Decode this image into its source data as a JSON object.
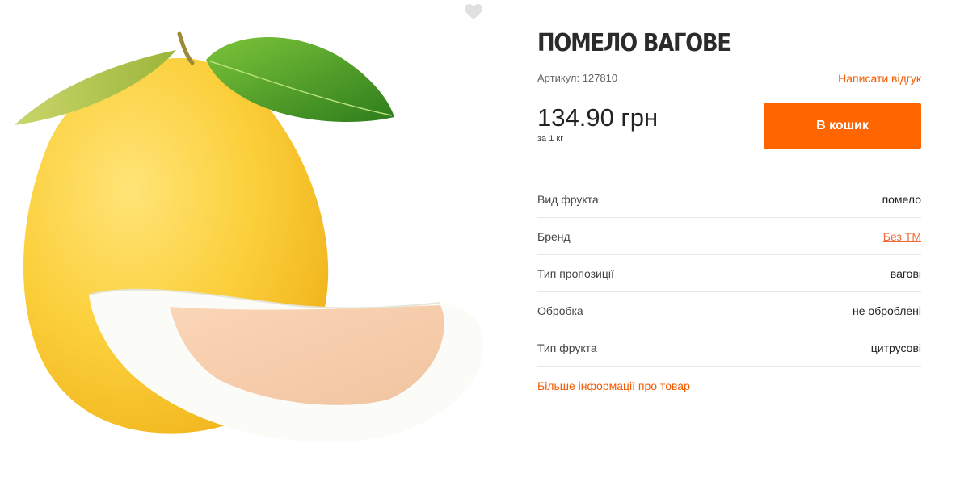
{
  "product": {
    "title": "ПОМЕЛО ВАГОВЕ",
    "sku_label": "Артикул:",
    "sku_value": "127810",
    "review_link": "Написати відгук",
    "price": "134.90 грн",
    "unit": "за 1 кг",
    "cart_button": "В кошик",
    "image_alt": "pomelo-fruit-image"
  },
  "specs": [
    {
      "label": "Вид фрукта",
      "value": "помело"
    },
    {
      "label": "Бренд",
      "value": "Без ТМ"
    },
    {
      "label": "Тип пропозиції",
      "value": "вагові"
    },
    {
      "label": "Обробка",
      "value": "не оброблені"
    },
    {
      "label": "Тип фрукта",
      "value": "цитрусові"
    }
  ],
  "more_info_link": "Більше інформації про товар",
  "icons": {
    "favorite": "heart-icon"
  },
  "colors": {
    "accent": "#ff6600",
    "link": "#f35b00",
    "brand_link": "#f06a3a",
    "divider": "#e8e8e8"
  }
}
